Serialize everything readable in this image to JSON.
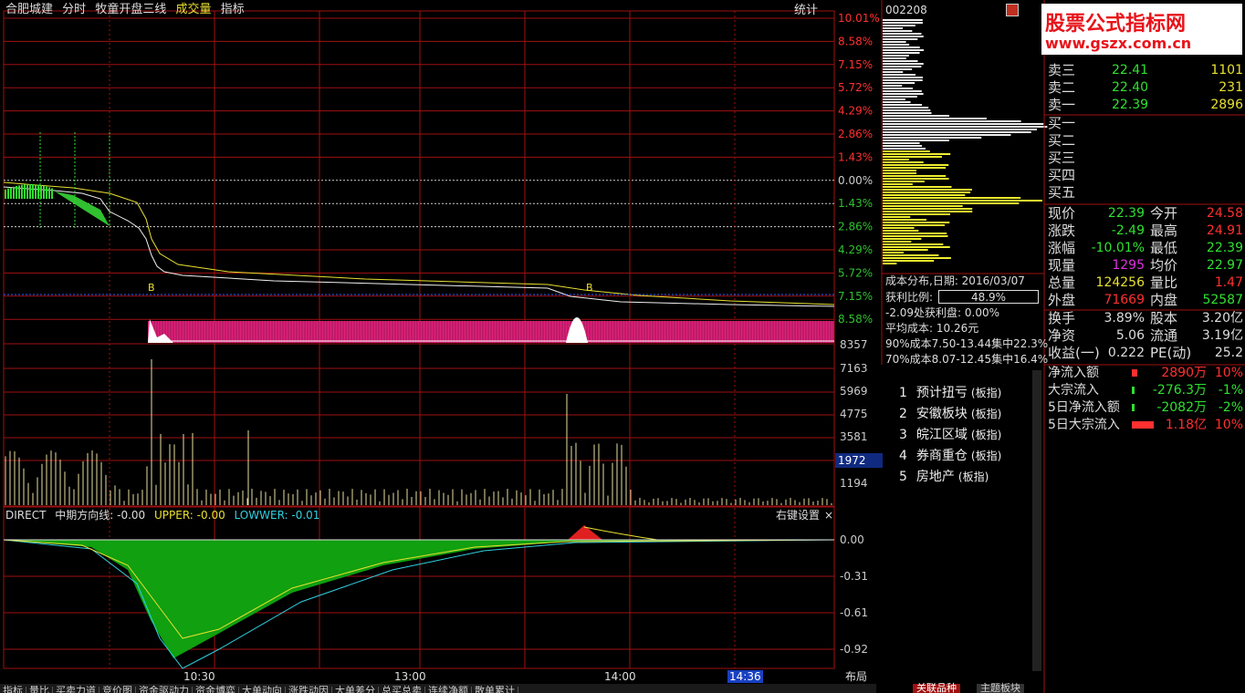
{
  "toolbar": {
    "stock_name": "合肥城建",
    "items": [
      "分时",
      "牧童开盘三线",
      "成交量",
      "指标"
    ],
    "stats_label": "统计"
  },
  "price_axis": {
    "labels": [
      "10.01%",
      "8.58%",
      "7.15%",
      "5.72%",
      "4.29%",
      "2.86%",
      "1.43%",
      "0.00%",
      "1.43%",
      "2.86%",
      "4.29%",
      "5.72%",
      "7.15%",
      "8.58%"
    ],
    "colors": [
      "#ff3030",
      "#ff3030",
      "#ff3030",
      "#ff3030",
      "#ff3030",
      "#ff3030",
      "#ff3030",
      "#cccccc",
      "#30c030",
      "#30c030",
      "#30c030",
      "#30c030",
      "#30c030",
      "#30c030"
    ]
  },
  "volume_axis": {
    "labels": [
      "8357",
      "7163",
      "5969",
      "4775",
      "3581",
      "1194"
    ],
    "highlight": "1972"
  },
  "indicator": {
    "name": "DIRECT",
    "line1": "中期方向线: -0.00",
    "upper": "UPPER: -0.00",
    "lower": "LOWWER: -0.01",
    "settings": "右键设置",
    "close": "×",
    "axis": [
      "0.00",
      "-0.31",
      "-0.61",
      "-0.92"
    ]
  },
  "time_axis": {
    "labels": [
      "10:30",
      "13:00",
      "14:00"
    ],
    "current": "14:36",
    "layout_btn": "布局"
  },
  "markers": {
    "b1": "B",
    "b2": "B"
  },
  "bottom_tabs": [
    "指标",
    "量比",
    "买卖力道",
    "竞价图",
    "资金驱动力",
    "资金博弈",
    "大单动向",
    "涨跌动因",
    "大单差分",
    "总买总卖",
    "连续净额",
    "散单累计"
  ],
  "bottom_right_tabs": [
    "关联品种",
    "主题板块"
  ],
  "chip": {
    "code": "002208",
    "date_label": "成本分布,日期: 2016/03/07",
    "profit_label": "获利比例:",
    "profit_value": "48.9%",
    "line1": "-2.09处获利盘: 0.00%",
    "line2": "平均成本: 10.26元",
    "line3": "90%成本7.50-13.44集中22.3%",
    "line4": "70%成本8.07-12.45集中16.4%"
  },
  "sectors": [
    {
      "num": "1",
      "name": "预计扭亏",
      "tag": "(板指)"
    },
    {
      "num": "2",
      "name": "安徽板块",
      "tag": "(板指)"
    },
    {
      "num": "3",
      "name": "皖江区域",
      "tag": "(板指)"
    },
    {
      "num": "4",
      "name": "券商重仓",
      "tag": "(板指)"
    },
    {
      "num": "5",
      "name": "房地产",
      "tag": "(板指)"
    }
  ],
  "logo": {
    "main": "股票公式指标网",
    "url": "www.gszx.com.cn"
  },
  "orderbook": {
    "sells": [
      {
        "label": "卖三",
        "price": "22.41",
        "vol": "1101"
      },
      {
        "label": "卖二",
        "price": "22.40",
        "vol": "231"
      },
      {
        "label": "卖一",
        "price": "22.39",
        "vol": "2896"
      }
    ],
    "buys": [
      "买一",
      "买二",
      "买三",
      "买四",
      "买五"
    ]
  },
  "quote": [
    {
      "l1": "现价",
      "v1": "22.39",
      "c1": "#30e030",
      "l2": "今开",
      "v2": "24.58",
      "c2": "#ff3030"
    },
    {
      "l1": "涨跌",
      "v1": "-2.49",
      "c1": "#30e030",
      "l2": "最高",
      "v2": "24.91",
      "c2": "#ff3030"
    },
    {
      "l1": "涨幅",
      "v1": "-10.01%",
      "c1": "#30e030",
      "l2": "最低",
      "v2": "22.39",
      "c2": "#30e030"
    },
    {
      "l1": "现量",
      "v1": "1295",
      "c1": "#e030e0",
      "l2": "均价",
      "v2": "22.97",
      "c2": "#30e030"
    },
    {
      "l1": "总量",
      "v1": "124256",
      "c1": "#e8e030",
      "l2": "量比",
      "v2": "1.47",
      "c2": "#ff3030"
    },
    {
      "l1": "外盘",
      "v1": "71669",
      "c1": "#ff3030",
      "l2": "内盘",
      "v2": "52587",
      "c2": "#30e030"
    }
  ],
  "quote2": [
    {
      "l1": "换手",
      "v1": "3.89%",
      "l2": "股本",
      "v2": "3.20亿"
    },
    {
      "l1": "净资",
      "v1": "5.06",
      "l2": "流通",
      "v2": "3.19亿"
    },
    {
      "l1": "收益(一)",
      "v1": "0.222",
      "l2": "PE(动)",
      "v2": "25.2"
    }
  ],
  "flows": [
    {
      "label": "净流入额",
      "value": "2890万",
      "pct": "10%",
      "color": "#ff3030",
      "bar": 0.1
    },
    {
      "label": "大宗流入",
      "value": "-276.3万",
      "pct": "-1%",
      "color": "#30e030",
      "bar": 0.01
    },
    {
      "label": "5日净流入额",
      "value": "-2082万",
      "pct": "-2%",
      "color": "#30e030",
      "bar": 0.02
    },
    {
      "label": "5日大宗流入",
      "value": "1.18亿",
      "pct": "10%",
      "color": "#ff3030",
      "bar": 0.4
    }
  ]
}
